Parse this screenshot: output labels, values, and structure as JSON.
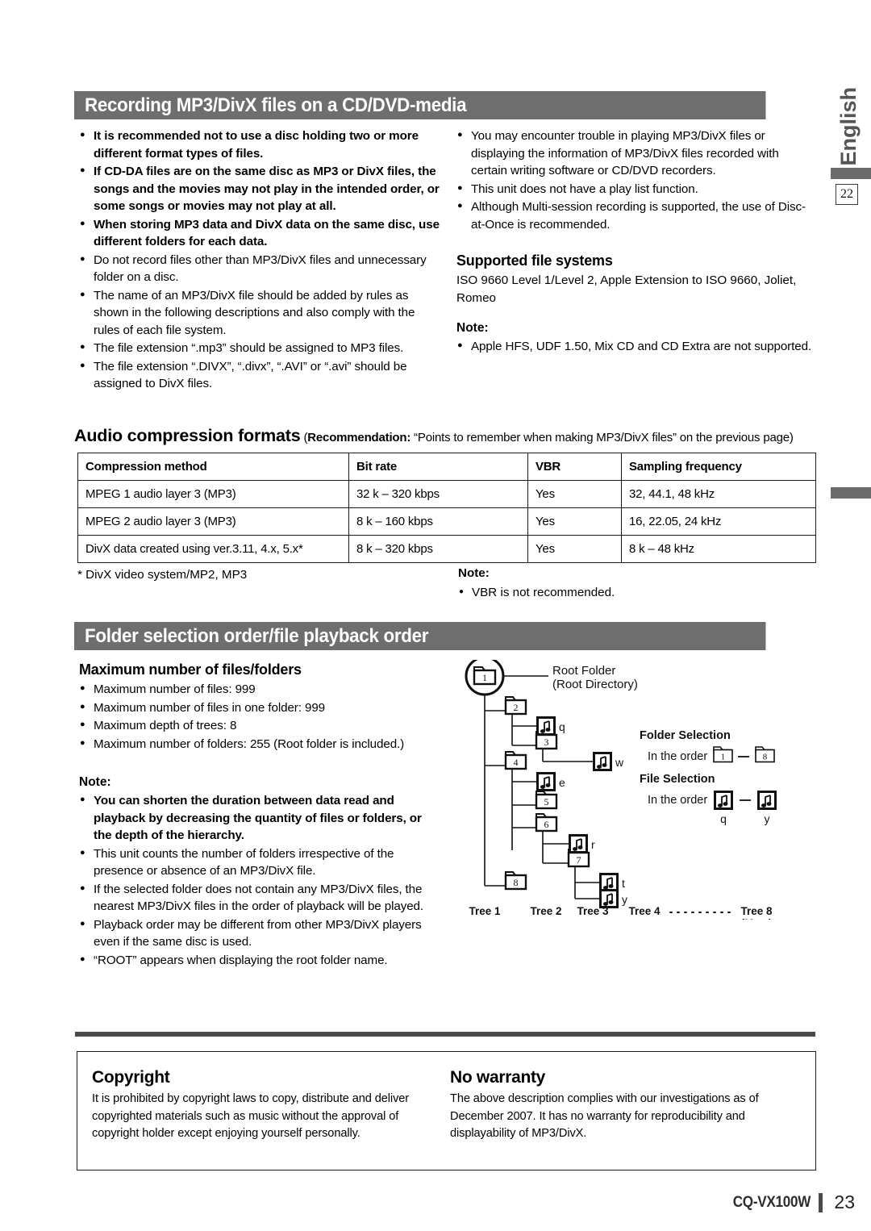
{
  "edge": {
    "language": "English",
    "page_ref": "22"
  },
  "sections": {
    "recording": {
      "title": "Recording MP3/DivX files on a CD/DVD-media",
      "left_bullets": [
        {
          "text": "It is recommended not to use a disc holding two or more different format types of files.",
          "bold": true
        },
        {
          "text": "If CD-DA files are on the same disc as MP3 or DivX files, the songs and the movies may not play in the intended order, or some songs or movies may not play at all.",
          "bold": true
        },
        {
          "text": "When storing MP3 data and DivX data on the same disc, use different folders for each data.",
          "bold": true
        },
        {
          "text": "Do not record files other than MP3/DivX files and unnecessary folder on a disc.",
          "bold": false
        },
        {
          "text": "The name of an MP3/DivX file should be added by rules as shown in the following descriptions and also comply with the rules of each file system.",
          "bold": false
        },
        {
          "text": "The file extension “.mp3” should be assigned to MP3 files.",
          "bold": false
        },
        {
          "text": "The file extension “.DIVX”, “.divx”, “.AVI” or “.avi” should be assigned to DivX files.",
          "bold": false
        }
      ],
      "right_bullets": [
        {
          "text": "You may encounter trouble in playing MP3/DivX files or displaying the information of MP3/DivX files recorded with certain writing software or CD/DVD recorders.",
          "bold": false
        },
        {
          "text": "This unit does not have a play list function.",
          "bold": false
        },
        {
          "text": "Although Multi-session recording is supported, the use of Disc-at-Once is recommended.",
          "bold": false
        }
      ],
      "supported": {
        "heading": "Supported file systems",
        "body": "ISO 9660 Level 1/Level 2, Apple Extension to ISO 9660, Joliet, Romeo",
        "note_label": "Note:",
        "note_bullets": [
          "Apple HFS, UDF 1.50, Mix CD and CD Extra are not supported."
        ]
      }
    },
    "audio_formats": {
      "heading": "Audio compression formats",
      "recommendation_label": "Recommendation:",
      "recommendation_text": "“Points to remember when making MP3/DivX files” on the previous page)",
      "recommendation_open": "(",
      "footnote": "* DivX video system/MP2, MP3",
      "note_label": "Note:",
      "note_bullet": "VBR is not recommended."
    },
    "folder_order": {
      "title": "Folder selection order/file playback order",
      "max_heading": "Maximum number of files/folders",
      "max_bullets": [
        "Maximum number of files: 999",
        "Maximum number of files in one folder: 999",
        "Maximum depth of trees: 8",
        "Maximum number of folders: 255 (Root folder is included.)"
      ],
      "note_label": "Note:",
      "note_bullets": [
        {
          "text": "You can shorten the duration between data read and playback by decreasing the quantity of files or folders, or the depth of the hierarchy.",
          "bold": true
        },
        {
          "text": "This unit counts the number of folders irrespective of the presence or absence of an MP3/DivX file.",
          "bold": false
        },
        {
          "text": "If the selected folder does not contain any MP3/DivX files, the nearest MP3/DivX files in the order of playback will be played.",
          "bold": false
        },
        {
          "text": "Playback order may be different from other MP3/DivX players even if the same disc is used.",
          "bold": false
        },
        {
          "text": "“ROOT” appears when displaying the root folder name.",
          "bold": false
        }
      ]
    }
  },
  "table": {
    "headers": [
      "Compression method",
      "Bit rate",
      "VBR",
      "Sampling frequency"
    ],
    "rows": [
      [
        "MPEG 1 audio layer 3 (MP3)",
        "32 k – 320 kbps",
        "Yes",
        "32, 44.1, 48 kHz"
      ],
      [
        "MPEG 2 audio layer 3 (MP3)",
        "8 k – 160 kbps",
        "Yes",
        "16, 22.05, 24 kHz"
      ],
      [
        "DivX data created using ver.3.11, 4.x, 5.x*",
        "8 k – 320 kbps",
        "Yes",
        "8 k – 48 kHz"
      ]
    ]
  },
  "tree_diagram": {
    "root_label_line1": "Root Folder",
    "root_label_line2": "(Root Directory)",
    "folders": [
      "1",
      "2",
      "3",
      "4",
      "5",
      "6",
      "7",
      "8"
    ],
    "files": [
      "q",
      "w",
      "e",
      "r",
      "t",
      "y"
    ],
    "tree_labels": [
      "Tree 1",
      "Tree 2",
      "Tree 3",
      "Tree 4",
      "Tree 8"
    ],
    "tree_max_note": "(Max.)",
    "dots": "· · · · · · · · · · · · · · ·",
    "folder_selection": {
      "heading": "Folder Selection",
      "order_text": "In the order",
      "from": "1",
      "dash": "—",
      "to": "8"
    },
    "file_selection": {
      "heading": "File Selection",
      "order_text": "In the order",
      "from": "q",
      "dash": "—",
      "to": "y"
    }
  },
  "bottom": {
    "copyright": {
      "heading": "Copyright",
      "body": "It is prohibited by copyright laws to copy, distribute and deliver copyrighted materials such as music without the approval of copyright holder except enjoying yourself personally."
    },
    "warranty": {
      "heading": "No warranty",
      "body": "The above description complies with our investigations as of December 2007. It has no warranty for reproducibility and displayability of MP3/DivX."
    }
  },
  "footer": {
    "model": "CQ-VX100W",
    "page_number": "23"
  }
}
